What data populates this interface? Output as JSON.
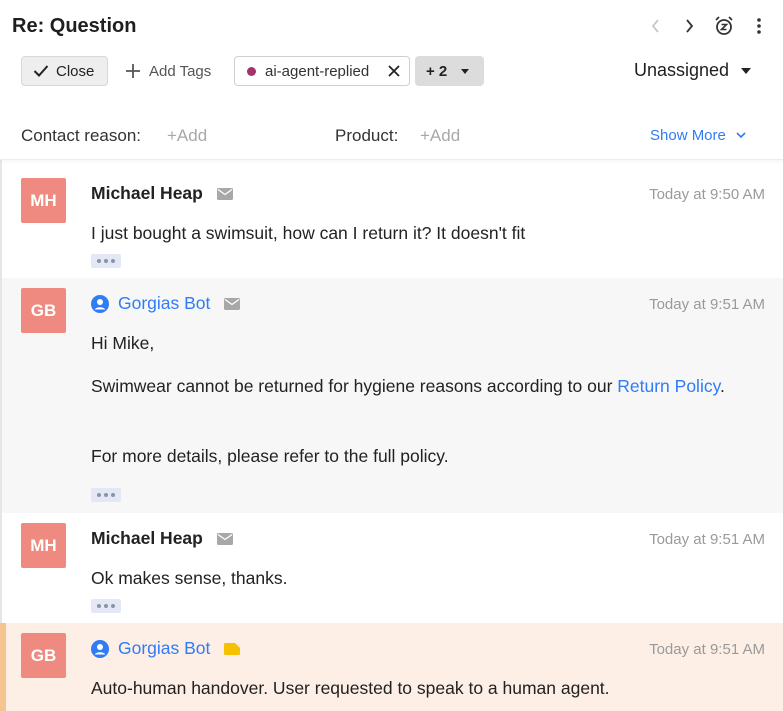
{
  "header": {
    "title": "Re: Question",
    "close_label": "Close",
    "add_tags_label": "Add Tags",
    "tag_label": "ai-agent-replied",
    "tag_color": "#a3336b",
    "more_tags_label": "+ 2",
    "assignee_label": "Unassigned"
  },
  "fields": {
    "contact_reason_label": "Contact reason:",
    "contact_reason_value": "+Add",
    "product_label": "Product:",
    "product_value": "+Add",
    "show_more_label": "Show More"
  },
  "messages": [
    {
      "initials": "MH",
      "sender": "Michael Heap",
      "channel_icon": "email-icon",
      "time": "Today at 9:50 AM",
      "body": [
        "I just bought a swimsuit, how can I return it? It doesn't fit"
      ]
    },
    {
      "initials": "GB",
      "sender": "Gorgias Bot",
      "channel_icon": "email-icon",
      "time": "Today at 9:51 AM",
      "greeting": "Hi Mike,",
      "line2_text": "Swimwear cannot be returned for hygiene reasons according to our ",
      "line2_link": "Return Policy",
      "line2_end": ".",
      "line3": "For more details, please refer to the full policy."
    },
    {
      "initials": "MH",
      "sender": "Michael Heap",
      "channel_icon": "email-icon",
      "time": "Today at 9:51 AM",
      "body": [
        "Ok makes sense, thanks."
      ]
    },
    {
      "initials": "GB",
      "sender": "Gorgias Bot",
      "channel_icon": "internal-note-icon",
      "time": "Today at 9:51 AM",
      "body": [
        "Auto-human handover. User requested to speak to a human agent."
      ]
    }
  ],
  "colors": {
    "accent": "#2f7cf6",
    "avatar": "#ee8a80",
    "note_bg": "#fdeee6",
    "note_border": "#f6c58f",
    "note_icon": "#f5c200"
  }
}
